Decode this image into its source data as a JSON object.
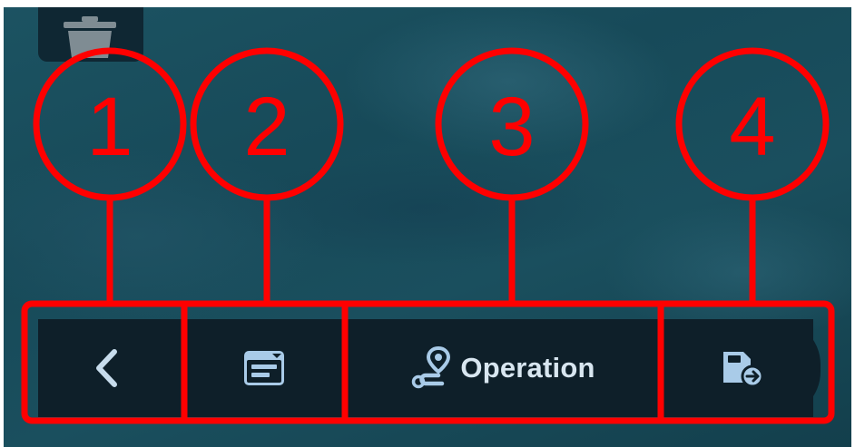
{
  "toolbar": {
    "back_icon": "chevron-left-icon",
    "panel_icon": "window-panel-icon",
    "operation_icon": "route-icon",
    "operation_label": "Operation",
    "export_icon": "file-export-icon"
  },
  "trash_icon": "trash-icon",
  "callouts": [
    "1",
    "2",
    "3",
    "4"
  ],
  "colors": {
    "annotation": "#ff0000",
    "toolbar_bg": "#0e1f29",
    "icon": "#a9cbe8",
    "label": "#d8e6f0"
  }
}
